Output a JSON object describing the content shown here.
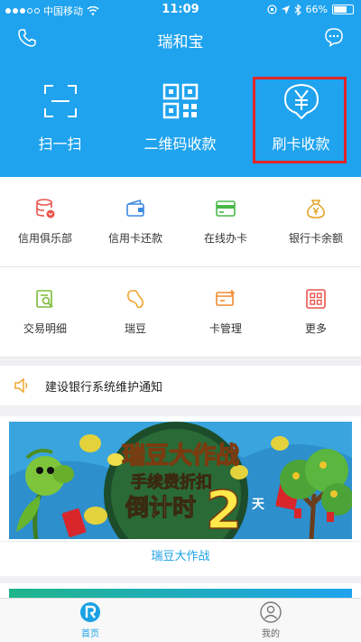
{
  "status_bar": {
    "carrier": "中国移动",
    "time": "11:09",
    "battery": "66%"
  },
  "header": {
    "title": "瑞和宝"
  },
  "hero_actions": [
    {
      "label": "扫一扫",
      "icon": "scan-icon"
    },
    {
      "label": "二维码收款",
      "icon": "qr-code-icon"
    },
    {
      "label": "刷卡收款",
      "icon": "yen-shield-icon"
    }
  ],
  "grid_row1": [
    {
      "label": "信用俱乐部",
      "icon": "database-icon"
    },
    {
      "label": "信用卡还款",
      "icon": "wallet-icon"
    },
    {
      "label": "在线办卡",
      "icon": "card-icon"
    },
    {
      "label": "银行卡余额",
      "icon": "money-bag-icon"
    }
  ],
  "grid_row2": [
    {
      "label": "交易明细",
      "icon": "receipt-search-icon"
    },
    {
      "label": "瑞豆",
      "icon": "bean-icon"
    },
    {
      "label": "卡管理",
      "icon": "card-add-icon"
    },
    {
      "label": "更多",
      "icon": "grid-more-icon"
    }
  ],
  "notice": {
    "text": "建设银行系统维护通知"
  },
  "banner": {
    "title": "瑞豆大作战",
    "line1": "手续费折扣",
    "line2": "倒计时",
    "days": "2",
    "days_unit": "天",
    "caption": "瑞豆大作战"
  },
  "tabbar": [
    {
      "label": "首页",
      "icon": "home-r-icon",
      "active": true
    },
    {
      "label": "我的",
      "icon": "user-icon",
      "active": false
    }
  ],
  "colors": {
    "brand": "#1fa3ee",
    "highlight": "#e0262b",
    "accent_text": "#1aa1e5"
  }
}
